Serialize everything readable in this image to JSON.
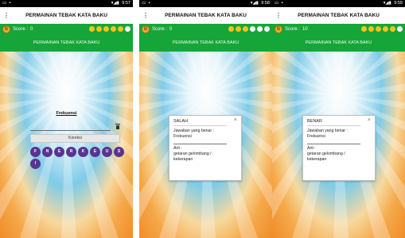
{
  "status_bar": {
    "left_icons": "▭ ▪",
    "right_indicators": "▾◢▮",
    "times": [
      "9:57",
      "9:58",
      "9:59"
    ]
  },
  "app": {
    "title": "PERMAINAN TEBAK KATA BAKU",
    "subheader": "PERMAINAN TEBAK KATA BAKU",
    "coin_letter": "B",
    "score_label": "Score :"
  },
  "screens": [
    {
      "score": "0",
      "dots": [
        "on",
        "on",
        "on",
        "on",
        "on",
        "off"
      ]
    },
    {
      "score": "0",
      "dots": [
        "on",
        "on",
        "on",
        "off",
        "off",
        "off"
      ]
    },
    {
      "score": "10",
      "dots": [
        "on",
        "on",
        "on",
        "on",
        "on",
        "off"
      ]
    }
  ],
  "game": {
    "question": "Frekuensi",
    "koreksi_label": "Koreksi",
    "letters": [
      "F",
      "N",
      "E",
      "R",
      "K",
      "E",
      "U",
      "S",
      "I"
    ]
  },
  "dialogs": [
    {
      "title": "SALAH",
      "answer_label": "Jawaban yang benar :",
      "answer_value": "Frekuensi",
      "meaning_label": "Arti :",
      "meaning_line1": "getaran gelombang /",
      "meaning_line2": "kekerapan"
    },
    {
      "title": "BENAR",
      "answer_label": "Jawaban yang benar :",
      "answer_value": "Frekuensi",
      "meaning_label": "Arti :",
      "meaning_line1": "getaran gelombang /",
      "meaning_line2": "kekerapan"
    }
  ],
  "icons": {
    "close": "×",
    "menu": "⋮"
  },
  "colors": {
    "green": "#16a538",
    "coin": "#e8b32c",
    "letter_bg": "#5b3392",
    "dot_on": "#f6c41f"
  }
}
